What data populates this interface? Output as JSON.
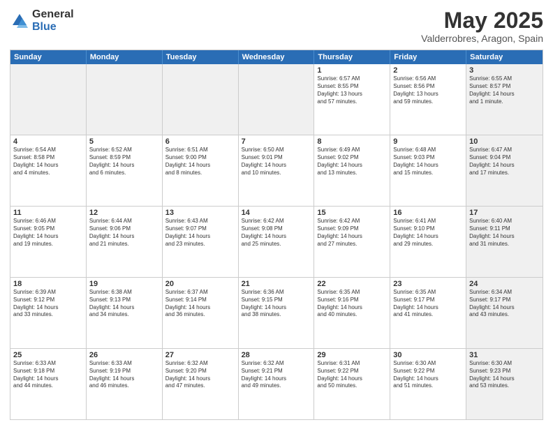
{
  "logo": {
    "general": "General",
    "blue": "Blue"
  },
  "title": "May 2025",
  "subtitle": "Valderrobres, Aragon, Spain",
  "header_days": [
    "Sunday",
    "Monday",
    "Tuesday",
    "Wednesday",
    "Thursday",
    "Friday",
    "Saturday"
  ],
  "weeks": [
    [
      {
        "day": "",
        "info": "",
        "shaded": true
      },
      {
        "day": "",
        "info": "",
        "shaded": true
      },
      {
        "day": "",
        "info": "",
        "shaded": true
      },
      {
        "day": "",
        "info": "",
        "shaded": true
      },
      {
        "day": "1",
        "info": "Sunrise: 6:57 AM\nSunset: 8:55 PM\nDaylight: 13 hours\nand 57 minutes.",
        "shaded": false
      },
      {
        "day": "2",
        "info": "Sunrise: 6:56 AM\nSunset: 8:56 PM\nDaylight: 13 hours\nand 59 minutes.",
        "shaded": false
      },
      {
        "day": "3",
        "info": "Sunrise: 6:55 AM\nSunset: 8:57 PM\nDaylight: 14 hours\nand 1 minute.",
        "shaded": true
      }
    ],
    [
      {
        "day": "4",
        "info": "Sunrise: 6:54 AM\nSunset: 8:58 PM\nDaylight: 14 hours\nand 4 minutes.",
        "shaded": false
      },
      {
        "day": "5",
        "info": "Sunrise: 6:52 AM\nSunset: 8:59 PM\nDaylight: 14 hours\nand 6 minutes.",
        "shaded": false
      },
      {
        "day": "6",
        "info": "Sunrise: 6:51 AM\nSunset: 9:00 PM\nDaylight: 14 hours\nand 8 minutes.",
        "shaded": false
      },
      {
        "day": "7",
        "info": "Sunrise: 6:50 AM\nSunset: 9:01 PM\nDaylight: 14 hours\nand 10 minutes.",
        "shaded": false
      },
      {
        "day": "8",
        "info": "Sunrise: 6:49 AM\nSunset: 9:02 PM\nDaylight: 14 hours\nand 13 minutes.",
        "shaded": false
      },
      {
        "day": "9",
        "info": "Sunrise: 6:48 AM\nSunset: 9:03 PM\nDaylight: 14 hours\nand 15 minutes.",
        "shaded": false
      },
      {
        "day": "10",
        "info": "Sunrise: 6:47 AM\nSunset: 9:04 PM\nDaylight: 14 hours\nand 17 minutes.",
        "shaded": true
      }
    ],
    [
      {
        "day": "11",
        "info": "Sunrise: 6:46 AM\nSunset: 9:05 PM\nDaylight: 14 hours\nand 19 minutes.",
        "shaded": false
      },
      {
        "day": "12",
        "info": "Sunrise: 6:44 AM\nSunset: 9:06 PM\nDaylight: 14 hours\nand 21 minutes.",
        "shaded": false
      },
      {
        "day": "13",
        "info": "Sunrise: 6:43 AM\nSunset: 9:07 PM\nDaylight: 14 hours\nand 23 minutes.",
        "shaded": false
      },
      {
        "day": "14",
        "info": "Sunrise: 6:42 AM\nSunset: 9:08 PM\nDaylight: 14 hours\nand 25 minutes.",
        "shaded": false
      },
      {
        "day": "15",
        "info": "Sunrise: 6:42 AM\nSunset: 9:09 PM\nDaylight: 14 hours\nand 27 minutes.",
        "shaded": false
      },
      {
        "day": "16",
        "info": "Sunrise: 6:41 AM\nSunset: 9:10 PM\nDaylight: 14 hours\nand 29 minutes.",
        "shaded": false
      },
      {
        "day": "17",
        "info": "Sunrise: 6:40 AM\nSunset: 9:11 PM\nDaylight: 14 hours\nand 31 minutes.",
        "shaded": true
      }
    ],
    [
      {
        "day": "18",
        "info": "Sunrise: 6:39 AM\nSunset: 9:12 PM\nDaylight: 14 hours\nand 33 minutes.",
        "shaded": false
      },
      {
        "day": "19",
        "info": "Sunrise: 6:38 AM\nSunset: 9:13 PM\nDaylight: 14 hours\nand 34 minutes.",
        "shaded": false
      },
      {
        "day": "20",
        "info": "Sunrise: 6:37 AM\nSunset: 9:14 PM\nDaylight: 14 hours\nand 36 minutes.",
        "shaded": false
      },
      {
        "day": "21",
        "info": "Sunrise: 6:36 AM\nSunset: 9:15 PM\nDaylight: 14 hours\nand 38 minutes.",
        "shaded": false
      },
      {
        "day": "22",
        "info": "Sunrise: 6:35 AM\nSunset: 9:16 PM\nDaylight: 14 hours\nand 40 minutes.",
        "shaded": false
      },
      {
        "day": "23",
        "info": "Sunrise: 6:35 AM\nSunset: 9:17 PM\nDaylight: 14 hours\nand 41 minutes.",
        "shaded": false
      },
      {
        "day": "24",
        "info": "Sunrise: 6:34 AM\nSunset: 9:17 PM\nDaylight: 14 hours\nand 43 minutes.",
        "shaded": true
      }
    ],
    [
      {
        "day": "25",
        "info": "Sunrise: 6:33 AM\nSunset: 9:18 PM\nDaylight: 14 hours\nand 44 minutes.",
        "shaded": false
      },
      {
        "day": "26",
        "info": "Sunrise: 6:33 AM\nSunset: 9:19 PM\nDaylight: 14 hours\nand 46 minutes.",
        "shaded": false
      },
      {
        "day": "27",
        "info": "Sunrise: 6:32 AM\nSunset: 9:20 PM\nDaylight: 14 hours\nand 47 minutes.",
        "shaded": false
      },
      {
        "day": "28",
        "info": "Sunrise: 6:32 AM\nSunset: 9:21 PM\nDaylight: 14 hours\nand 49 minutes.",
        "shaded": false
      },
      {
        "day": "29",
        "info": "Sunrise: 6:31 AM\nSunset: 9:22 PM\nDaylight: 14 hours\nand 50 minutes.",
        "shaded": false
      },
      {
        "day": "30",
        "info": "Sunrise: 6:30 AM\nSunset: 9:22 PM\nDaylight: 14 hours\nand 51 minutes.",
        "shaded": false
      },
      {
        "day": "31",
        "info": "Sunrise: 6:30 AM\nSunset: 9:23 PM\nDaylight: 14 hours\nand 53 minutes.",
        "shaded": true
      }
    ]
  ]
}
